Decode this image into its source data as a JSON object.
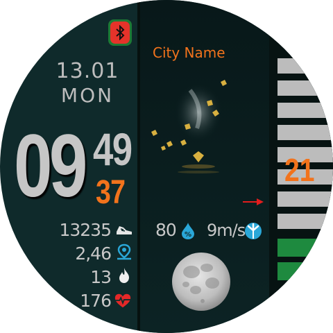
{
  "status": {
    "bluetooth_icon": "bluetooth-icon",
    "bluetooth_color": "#e5332a"
  },
  "date": {
    "date_text": "13.01",
    "weekday": "MON"
  },
  "time": {
    "hour": "09",
    "minute": "49",
    "second": "37"
  },
  "activity": {
    "steps": "13235",
    "distance": "2,46",
    "calories": "13",
    "heart_rate": "176"
  },
  "weather": {
    "city": "City Name",
    "temperature": "21",
    "humidity": "80",
    "wind": "9m/s",
    "condition_icon": "leaves-wind-icon"
  },
  "moon": {
    "phase_icon": "full-moon-icon"
  },
  "colors": {
    "accent": "#f2731c",
    "text": "#c6c6c6",
    "bar_inactive": "#bcbcbc",
    "bar_active": "#1e8a3f",
    "indicator": "#e31d1d"
  }
}
